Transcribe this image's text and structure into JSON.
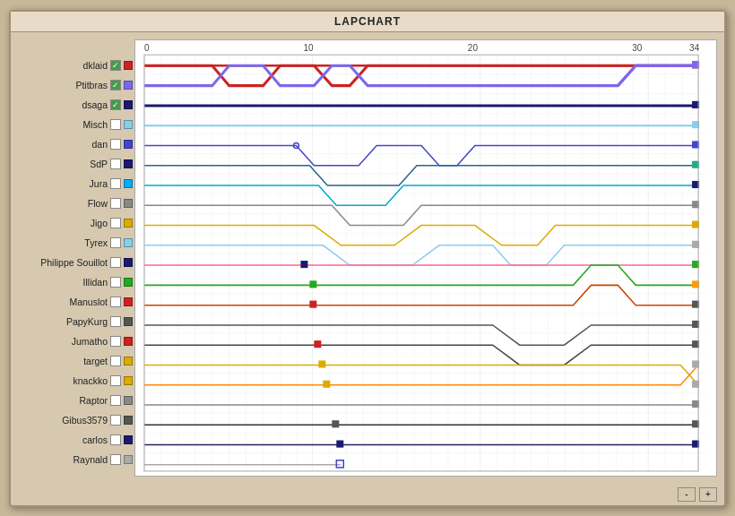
{
  "title": "LAPCHART",
  "drivers": [
    {
      "name": "dklaid",
      "checked": true,
      "color": "#cc2222"
    },
    {
      "name": "Ptitbras",
      "checked": true,
      "color": "#7b68ee"
    },
    {
      "name": "dsaga",
      "checked": true,
      "color": "#1a1a6e"
    },
    {
      "name": "Misch",
      "checked": false,
      "color": "#87ceeb"
    },
    {
      "name": "dan",
      "checked": false,
      "color": "#4444cc"
    },
    {
      "name": "SdP",
      "checked": false,
      "color": "#1a1a6e"
    },
    {
      "name": "Jura",
      "checked": false,
      "color": "#00aaff"
    },
    {
      "name": "Flow",
      "checked": false,
      "color": "#888888"
    },
    {
      "name": "Jigo",
      "checked": false,
      "color": "#ddaa00"
    },
    {
      "name": "Tyrex",
      "checked": false,
      "color": "#87ceeb"
    },
    {
      "name": "Philippe Souillot",
      "checked": false,
      "color": "#1a1a6e"
    },
    {
      "name": "Illidan",
      "checked": false,
      "color": "#22aa22"
    },
    {
      "name": "Manuslot",
      "checked": false,
      "color": "#cc2222"
    },
    {
      "name": "PapyKurg",
      "checked": false,
      "color": "#555555"
    },
    {
      "name": "Jumatho",
      "checked": false,
      "color": "#cc2222"
    },
    {
      "name": "target",
      "checked": false,
      "color": "#ddaa00"
    },
    {
      "name": "knackko",
      "checked": false,
      "color": "#ddaa00"
    },
    {
      "name": "Raptor",
      "checked": false,
      "color": "#888888"
    },
    {
      "name": "Gibus3579",
      "checked": false,
      "color": "#555555"
    },
    {
      "name": "carlos",
      "checked": false,
      "color": "#1a1a6e"
    },
    {
      "name": "Raynald",
      "checked": false,
      "color": "#aaaaaa"
    }
  ],
  "axis": {
    "start": 0,
    "marks": [
      0,
      10,
      20,
      30,
      34
    ],
    "end": 34
  },
  "buttons": {
    "minus": "-",
    "plus": "+"
  }
}
